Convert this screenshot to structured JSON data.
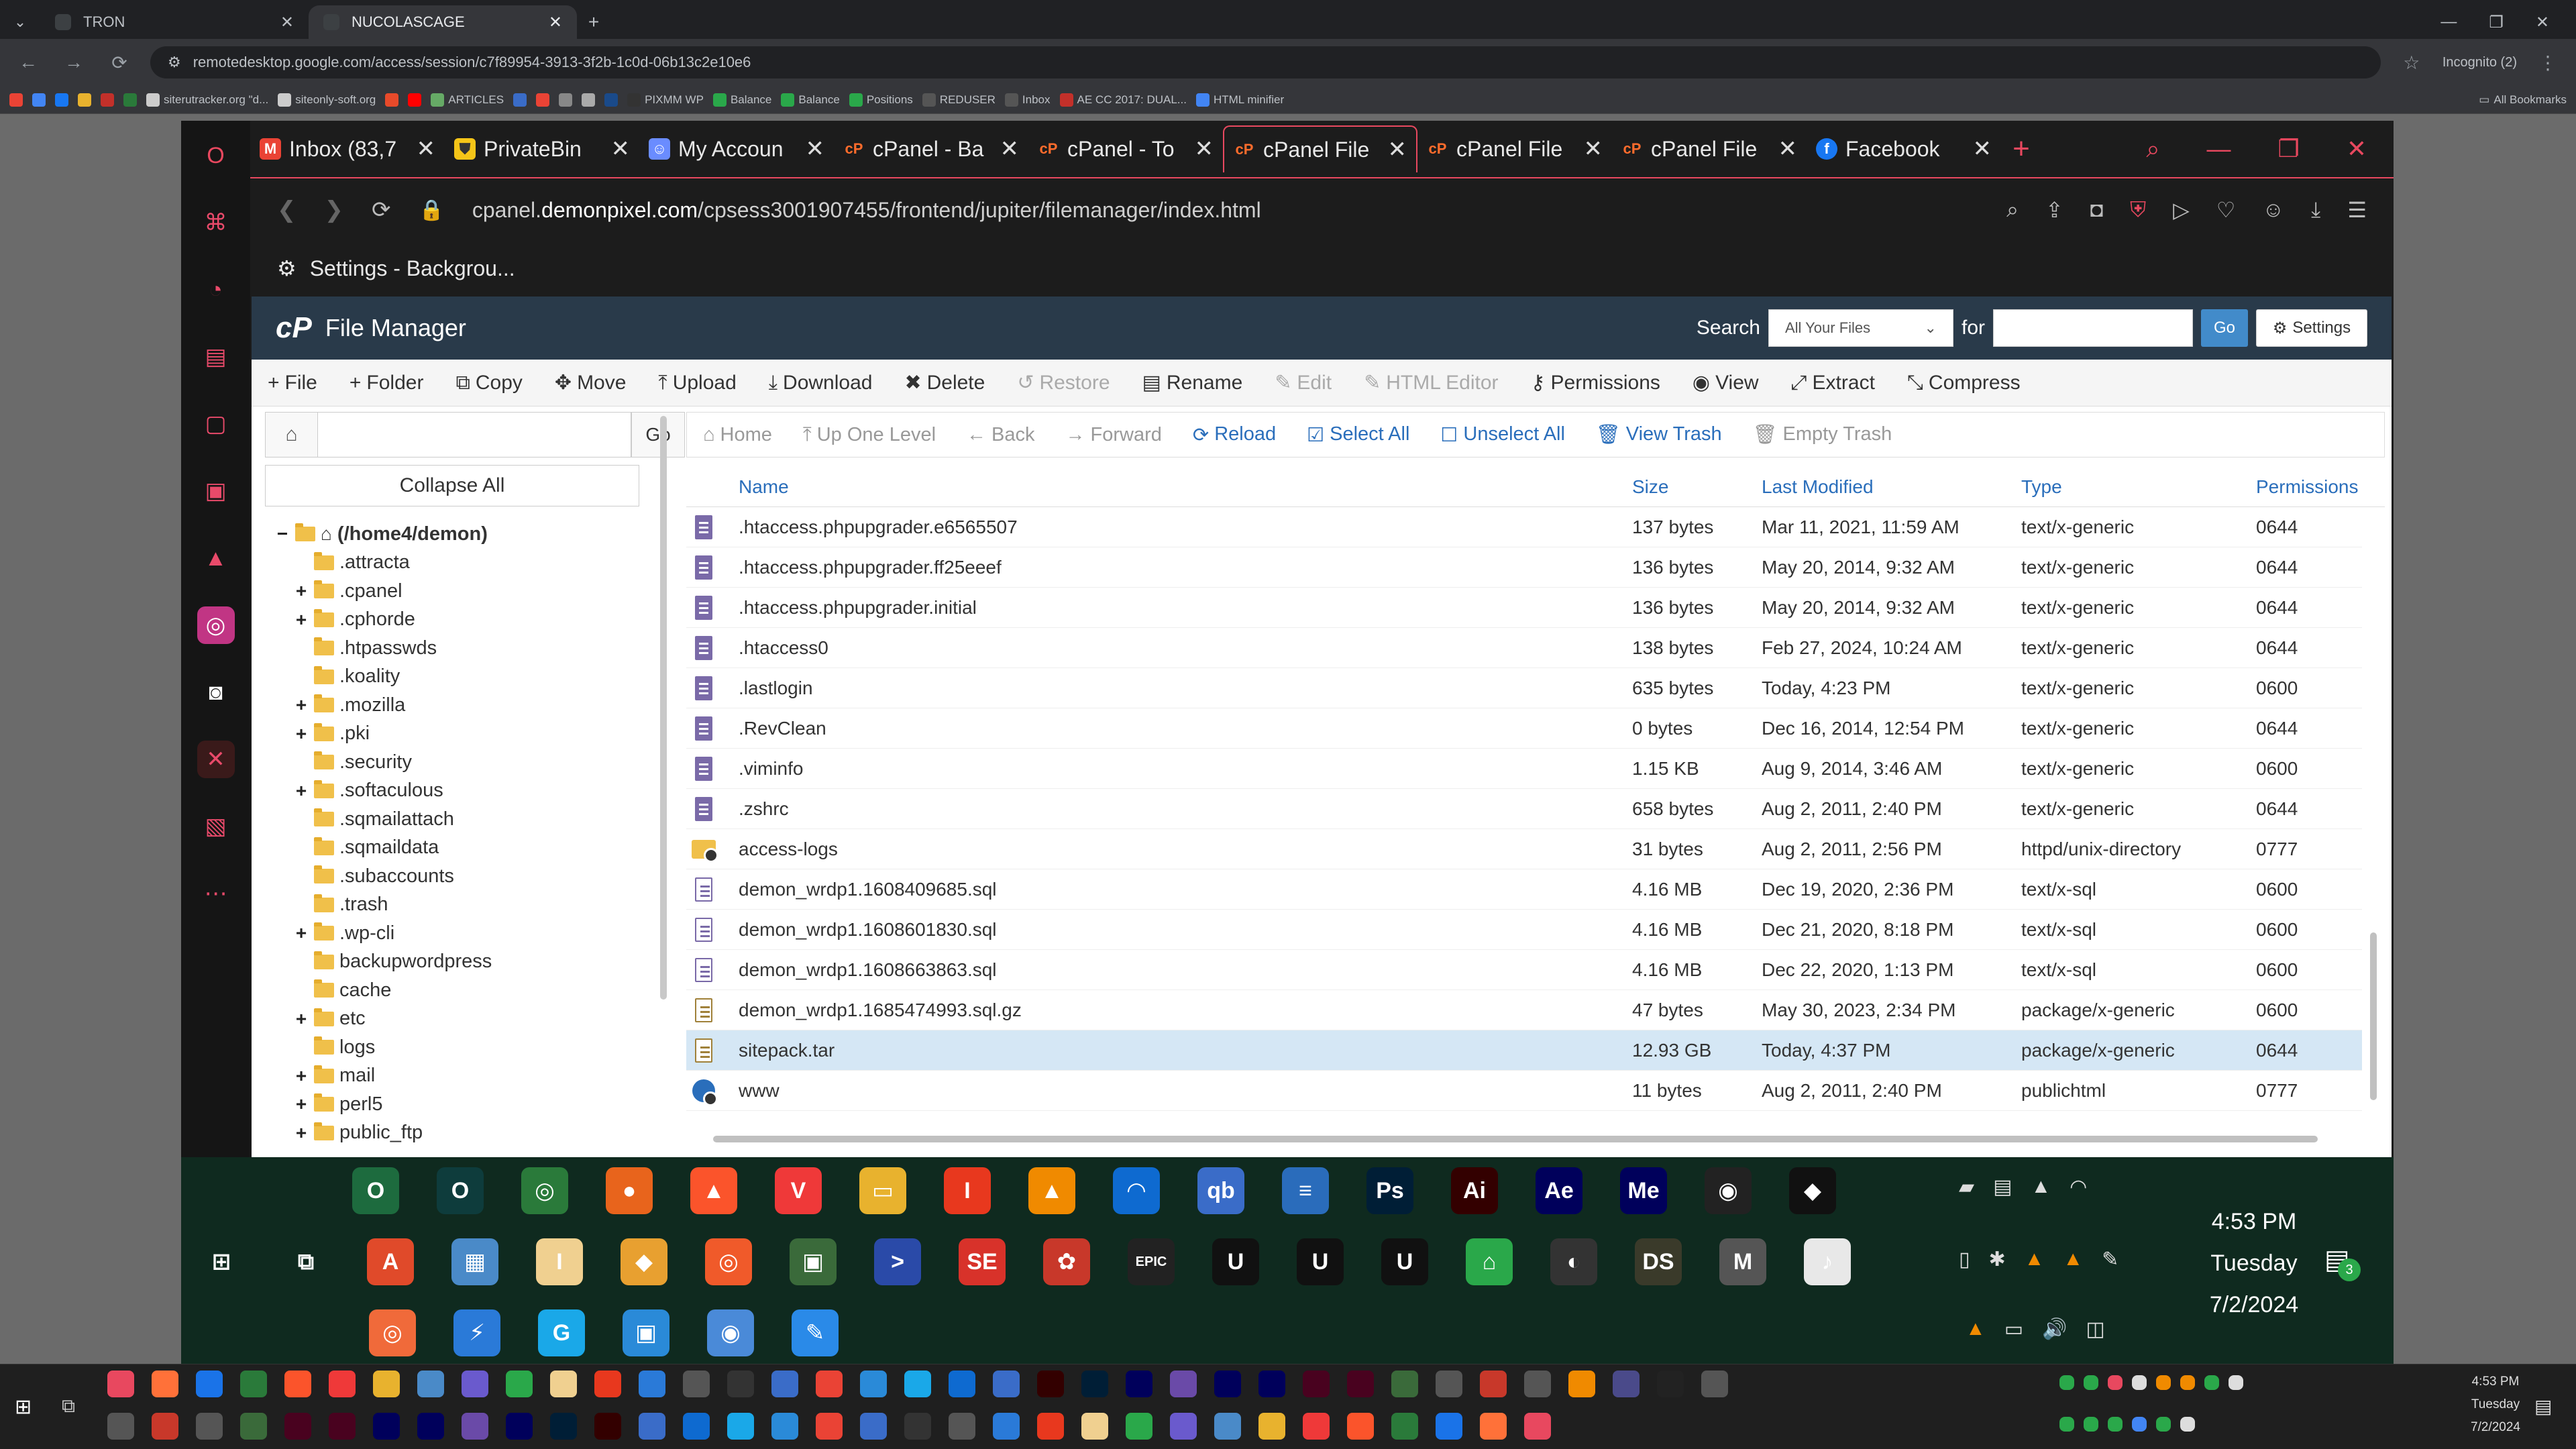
{
  "chrome": {
    "tabs": [
      {
        "title": "TRON",
        "active": false
      },
      {
        "title": "NUCOLASCAGE",
        "active": true
      }
    ],
    "url": "remotedesktop.google.com/access/session/c7f89954-3913-3f2b-1c0d-06b13c2e10e6",
    "incognito_label": "Incognito (2)",
    "all_bookmarks": "All Bookmarks",
    "bookmarks": [
      "siterutracker.org \"d...",
      "siteonly-soft.org",
      "ARTICLES",
      "PIXMM WP",
      "Balance",
      "Balance",
      "Positions",
      "REDUSER",
      "Inbox",
      "AE CC 2017: DUAL...",
      "HTML minifier"
    ]
  },
  "opera": {
    "tabs": [
      {
        "title": "Inbox (83,7",
        "icon": "gmail-icon",
        "color": "#ea4335",
        "active": false
      },
      {
        "title": "PrivateBin",
        "icon": "privatebin-icon",
        "color": "#f5c518",
        "active": false
      },
      {
        "title": "My Accoun",
        "icon": "account-icon",
        "color": "#6a8cff",
        "active": false
      },
      {
        "title": "cPanel - Ba",
        "icon": "cpanel-icon",
        "color": "#ff6c2c",
        "active": false
      },
      {
        "title": "cPanel - To",
        "icon": "cpanel-icon",
        "color": "#ff6c2c",
        "active": false
      },
      {
        "title": "cPanel File",
        "icon": "cpanel-icon",
        "color": "#ff6c2c",
        "active": true
      },
      {
        "title": "cPanel File",
        "icon": "cpanel-icon",
        "color": "#ff6c2c",
        "active": false
      },
      {
        "title": "cPanel File",
        "icon": "cpanel-icon",
        "color": "#ff6c2c",
        "active": false
      },
      {
        "title": "Facebook",
        "icon": "facebook-icon",
        "color": "#1877f2",
        "active": false
      }
    ],
    "url_pre": "cpanel.",
    "url_domain": "demonpixel.com",
    "url_post": "/cpsess3001907455/frontend/jupiter/filemanager/index.html",
    "settings_label": "Settings - Backgrou..."
  },
  "cpanel": {
    "title": "File Manager",
    "search_label": "Search",
    "search_scope": "All Your Files",
    "for_label": "for",
    "go_label": "Go",
    "settings_label": "Settings",
    "toolbar": [
      {
        "label": "File",
        "glyph": "+",
        "enabled": true
      },
      {
        "label": "Folder",
        "glyph": "+",
        "enabled": true
      },
      {
        "label": "Copy",
        "glyph": "⧉",
        "enabled": true
      },
      {
        "label": "Move",
        "glyph": "✥",
        "enabled": true
      },
      {
        "label": "Upload",
        "glyph": "⤒",
        "enabled": true
      },
      {
        "label": "Download",
        "glyph": "⤓",
        "enabled": true
      },
      {
        "label": "Delete",
        "glyph": "✖",
        "enabled": true
      },
      {
        "label": "Restore",
        "glyph": "↺",
        "enabled": false
      },
      {
        "label": "Rename",
        "glyph": "▤",
        "enabled": true
      },
      {
        "label": "Edit",
        "glyph": "✎",
        "enabled": false
      },
      {
        "label": "HTML Editor",
        "glyph": "✎",
        "enabled": false
      },
      {
        "label": "Permissions",
        "glyph": "⚷",
        "enabled": true
      },
      {
        "label": "View",
        "glyph": "◉",
        "enabled": true
      },
      {
        "label": "Extract",
        "glyph": "⤢",
        "enabled": true
      },
      {
        "label": "Compress",
        "glyph": "⤡",
        "enabled": true
      }
    ],
    "tree_go": "Go",
    "collapse_all": "Collapse All",
    "tree": [
      {
        "label": "(/home4/demon)",
        "pm": "−",
        "root": true
      },
      {
        "label": ".attracta",
        "pm": ""
      },
      {
        "label": ".cpanel",
        "pm": "+"
      },
      {
        "label": ".cphorde",
        "pm": "+"
      },
      {
        "label": ".htpasswds",
        "pm": ""
      },
      {
        "label": ".koality",
        "pm": ""
      },
      {
        "label": ".mozilla",
        "pm": "+"
      },
      {
        "label": ".pki",
        "pm": "+"
      },
      {
        "label": ".security",
        "pm": ""
      },
      {
        "label": ".softaculous",
        "pm": "+"
      },
      {
        "label": ".sqmailattach",
        "pm": ""
      },
      {
        "label": ".sqmaildata",
        "pm": ""
      },
      {
        "label": ".subaccounts",
        "pm": ""
      },
      {
        "label": ".trash",
        "pm": ""
      },
      {
        "label": ".wp-cli",
        "pm": "+"
      },
      {
        "label": "backupwordpress",
        "pm": ""
      },
      {
        "label": "cache",
        "pm": ""
      },
      {
        "label": "etc",
        "pm": "+"
      },
      {
        "label": "logs",
        "pm": ""
      },
      {
        "label": "mail",
        "pm": "+"
      },
      {
        "label": "perl5",
        "pm": "+"
      },
      {
        "label": "public_ftp",
        "pm": "+"
      }
    ],
    "nav": [
      {
        "label": "Home",
        "glyph": "⌂",
        "on": false
      },
      {
        "label": "Up One Level",
        "glyph": "⤒",
        "on": false
      },
      {
        "label": "Back",
        "glyph": "←",
        "on": false
      },
      {
        "label": "Forward",
        "glyph": "→",
        "on": false
      },
      {
        "label": "Reload",
        "glyph": "⟳",
        "on": true
      },
      {
        "label": "Select All",
        "glyph": "☑",
        "on": true
      },
      {
        "label": "Unselect All",
        "glyph": "☐",
        "on": true
      },
      {
        "label": "View Trash",
        "glyph": "🗑",
        "on": true
      },
      {
        "label": "Empty Trash",
        "glyph": "🗑",
        "on": false
      }
    ],
    "columns": {
      "name": "Name",
      "size": "Size",
      "modified": "Last Modified",
      "type": "Type",
      "perms": "Permissions"
    },
    "files": [
      {
        "name": ".htaccess.phpupgrader.e6565507",
        "size": "137 bytes",
        "modified": "Mar 11, 2021, 11:59 AM",
        "type": "text/x-generic",
        "perms": "0644",
        "icon": "file"
      },
      {
        "name": ".htaccess.phpupgrader.ff25eeef",
        "size": "136 bytes",
        "modified": "May 20, 2014, 9:32 AM",
        "type": "text/x-generic",
        "perms": "0644",
        "icon": "file"
      },
      {
        "name": ".htaccess.phpupgrader.initial",
        "size": "136 bytes",
        "modified": "May 20, 2014, 9:32 AM",
        "type": "text/x-generic",
        "perms": "0644",
        "icon": "file"
      },
      {
        "name": ".htaccess0",
        "size": "138 bytes",
        "modified": "Feb 27, 2024, 10:24 AM",
        "type": "text/x-generic",
        "perms": "0644",
        "icon": "file"
      },
      {
        "name": ".lastlogin",
        "size": "635 bytes",
        "modified": "Today, 4:23 PM",
        "type": "text/x-generic",
        "perms": "0600",
        "icon": "file"
      },
      {
        "name": ".RevClean",
        "size": "0 bytes",
        "modified": "Dec 16, 2014, 12:54 PM",
        "type": "text/x-generic",
        "perms": "0644",
        "icon": "file"
      },
      {
        "name": ".viminfo",
        "size": "1.15 KB",
        "modified": "Aug 9, 2014, 3:46 AM",
        "type": "text/x-generic",
        "perms": "0600",
        "icon": "file"
      },
      {
        "name": ".zshrc",
        "size": "658 bytes",
        "modified": "Aug 2, 2011, 2:40 PM",
        "type": "text/x-generic",
        "perms": "0644",
        "icon": "file"
      },
      {
        "name": "access-logs",
        "size": "31 bytes",
        "modified": "Aug 2, 2011, 2:56 PM",
        "type": "httpd/unix-directory",
        "perms": "0777",
        "icon": "dir"
      },
      {
        "name": "demon_wrdp1.1608409685.sql",
        "size": "4.16 MB",
        "modified": "Dec 19, 2020, 2:36 PM",
        "type": "text/x-sql",
        "perms": "0600",
        "icon": "sql"
      },
      {
        "name": "demon_wrdp1.1608601830.sql",
        "size": "4.16 MB",
        "modified": "Dec 21, 2020, 8:18 PM",
        "type": "text/x-sql",
        "perms": "0600",
        "icon": "sql"
      },
      {
        "name": "demon_wrdp1.1608663863.sql",
        "size": "4.16 MB",
        "modified": "Dec 22, 2020, 1:13 PM",
        "type": "text/x-sql",
        "perms": "0600",
        "icon": "sql"
      },
      {
        "name": "demon_wrdp1.1685474993.sql.gz",
        "size": "47 bytes",
        "modified": "May 30, 2023, 2:34 PM",
        "type": "package/x-generic",
        "perms": "0600",
        "icon": "pkg"
      },
      {
        "name": "sitepack.tar",
        "size": "12.93 GB",
        "modified": "Today, 4:37 PM",
        "type": "package/x-generic",
        "perms": "0644",
        "icon": "pkg",
        "selected": true
      },
      {
        "name": "www",
        "size": "11 bytes",
        "modified": "Aug 2, 2011, 2:40 PM",
        "type": "publichtml",
        "perms": "0777",
        "icon": "www"
      }
    ]
  },
  "remote_clock": {
    "time": "4:53 PM",
    "day": "Tuesday",
    "date": "7/2/2024"
  },
  "remote_tray_badge": "3",
  "remote_taskbar": {
    "row1": [
      {
        "label": "O",
        "color": "#1d6b3e"
      },
      {
        "label": "O",
        "color": "#0e3c3c"
      },
      {
        "label": "◎",
        "color": "#2a7a3a"
      },
      {
        "label": "●",
        "color": "#e8641c"
      },
      {
        "label": "▲",
        "color": "#fb542b"
      },
      {
        "label": "V",
        "color": "#ef3939"
      },
      {
        "label": "▭",
        "color": "#e8b22e"
      },
      {
        "label": "I",
        "color": "#e8381e"
      },
      {
        "label": "▲",
        "color": "#f08a00"
      },
      {
        "label": "◠",
        "color": "#0e6ad0"
      },
      {
        "label": "qb",
        "color": "#3a6cc8"
      },
      {
        "label": "≡",
        "color": "#2a6cbb"
      },
      {
        "label": "Ps",
        "color": "#001e36"
      },
      {
        "label": "Ai",
        "color": "#330000"
      },
      {
        "label": "Ae",
        "color": "#00005b"
      },
      {
        "label": "Me",
        "color": "#00005b"
      },
      {
        "label": "◉",
        "color": "#222"
      },
      {
        "label": "◆",
        "color": "#111"
      }
    ],
    "row2": [
      {
        "label": "⊞",
        "color": "transparent"
      },
      {
        "label": "⧉",
        "color": "transparent"
      },
      {
        "label": "A",
        "color": "#e04a2a"
      },
      {
        "label": "▦",
        "color": "#4a8ac8"
      },
      {
        "label": "I",
        "color": "#f0d090"
      },
      {
        "label": "◆",
        "color": "#e8a030"
      },
      {
        "label": "◎",
        "color": "#f05a2a"
      },
      {
        "label": "▣",
        "color": "#3a6a3a"
      },
      {
        "label": ">",
        "color": "#2a4aa8"
      },
      {
        "label": "SE",
        "color": "#d8322a"
      },
      {
        "label": "✿",
        "color": "#c8382a"
      },
      {
        "label": "EPIC",
        "color": "#222"
      },
      {
        "label": "U",
        "color": "#111"
      },
      {
        "label": "U",
        "color": "#111"
      },
      {
        "label": "U",
        "color": "#111"
      },
      {
        "label": "⌂",
        "color": "#2aa84a"
      },
      {
        "label": "◐",
        "color": "#333"
      },
      {
        "label": "DS",
        "color": "#3a3a2a"
      },
      {
        "label": "M",
        "color": "#555"
      },
      {
        "label": "♪",
        "color": "#e8e8e8"
      }
    ],
    "row3": [
      {
        "label": "◎",
        "color": "#f06a3a"
      },
      {
        "label": "⚡",
        "color": "#2a7ad8"
      },
      {
        "label": "G",
        "color": "#1aa8e8"
      },
      {
        "label": "▣",
        "color": "#2a8ad8"
      },
      {
        "label": "◉",
        "color": "#4a8ad8"
      },
      {
        "label": "✎",
        "color": "#2a8ae8"
      }
    ]
  },
  "local_clock": {
    "time": "4:53 PM",
    "day": "Tuesday",
    "date": "7/2/2024"
  }
}
